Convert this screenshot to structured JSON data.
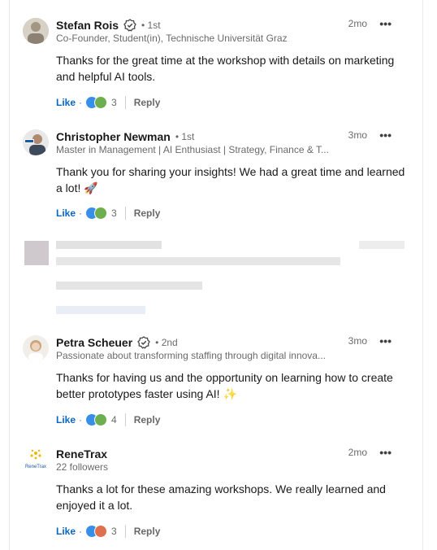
{
  "colors": {
    "link": "#0a66c2",
    "muted": "#666666",
    "rose": "#c95b47"
  },
  "comments": [
    {
      "name": "Stefan Rois",
      "verified": true,
      "degree": "• 1st",
      "headline": "Co-Founder, Student(in), Technische Universität Graz",
      "time": "2mo",
      "more": "•••",
      "text": "Thanks for the great time at the workshop with details on marketing and helpful AI tools.",
      "like": "Like",
      "dot": "·",
      "reactions": 3,
      "reply": "Reply"
    },
    {
      "name": "Christopher Newman",
      "verified": false,
      "degree": "• 1st",
      "headline": "Master in Management | AI Enthusiast | Strategy, Finance & T...",
      "time": "3mo",
      "more": "•••",
      "text": "Thank you for sharing your insights! We had a great time and learned a lot! 🚀",
      "like": "Like",
      "dot": "·",
      "reactions": 3,
      "reply": "Reply"
    },
    {
      "name": "Petra Scheuer",
      "verified": true,
      "degree": "• 2nd",
      "headline": "Passionate about transforming staffing through digital innova...",
      "time": "3mo",
      "more": "•••",
      "text": "Thanks for having us and the opportunity on learning how to create better prototypes faster using AI! ✨",
      "like": "Like",
      "dot": "·",
      "reactions": 4,
      "reply": "Reply"
    },
    {
      "name": "ReneTrax",
      "verified": false,
      "degree": "",
      "headline": "22 followers",
      "logo_text": "ReneTrax",
      "time": "2mo",
      "more": "•••",
      "text": "Thanks a lot for these amazing workshops. We really learned and enjoyed it a lot.",
      "like": "Like",
      "dot": "·",
      "reactions": 3,
      "reply": "Reply"
    }
  ]
}
